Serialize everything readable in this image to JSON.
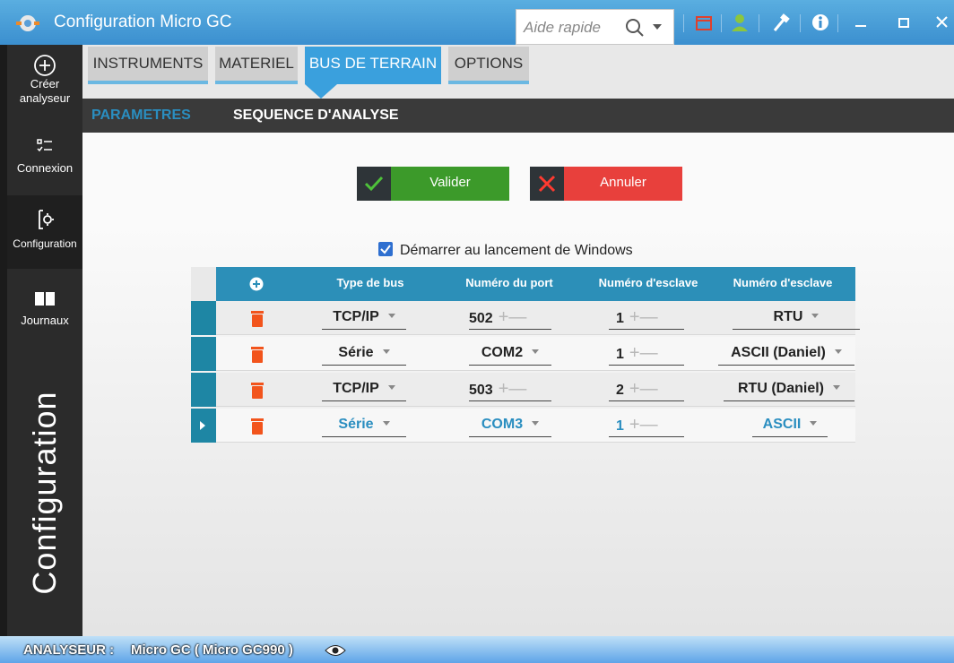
{
  "title": "Configuration Micro GC",
  "search": {
    "placeholder": "Aide rapide"
  },
  "nav": {
    "create": "Créer analyseur",
    "connexion": "Connexion",
    "configuration": "Configuration",
    "journaux": "Journaux",
    "vertical_title": "Configuration"
  },
  "tabs": [
    "INSTRUMENTS",
    "MATERIEL",
    "BUS DE TERRAIN",
    "OPTIONS"
  ],
  "subtabs": [
    "PARAMETRES",
    "SEQUENCE D'ANALYSE"
  ],
  "buttons": {
    "validate": "Valider",
    "cancel": "Annuler"
  },
  "autostart_label": "Démarrer au lancement de Windows",
  "grid": {
    "headers": [
      "Type de bus",
      "Numéro du port",
      "Numéro d'esclave",
      "Numéro d'esclave"
    ],
    "rows": [
      {
        "bus": "TCP/IP",
        "port": "502",
        "slave": "1",
        "protocol": "RTU"
      },
      {
        "bus": "Série",
        "port": "COM2",
        "slave": "1",
        "protocol": "ASCII (Daniel)"
      },
      {
        "bus": "TCP/IP",
        "port": "503",
        "slave": "2",
        "protocol": "RTU (Daniel)"
      },
      {
        "bus": "Série",
        "port": "COM3",
        "slave": "1",
        "protocol": "ASCII"
      }
    ]
  },
  "status": {
    "label": "ANALYSEUR :",
    "value": "Micro GC ( Micro GC990 )"
  },
  "colors": {
    "accent": "#3aa0dd",
    "grid_header": "#2c8fb8",
    "validate": "#3c9a2a",
    "cancel": "#e8403c",
    "nav": "#2b2b2b"
  }
}
